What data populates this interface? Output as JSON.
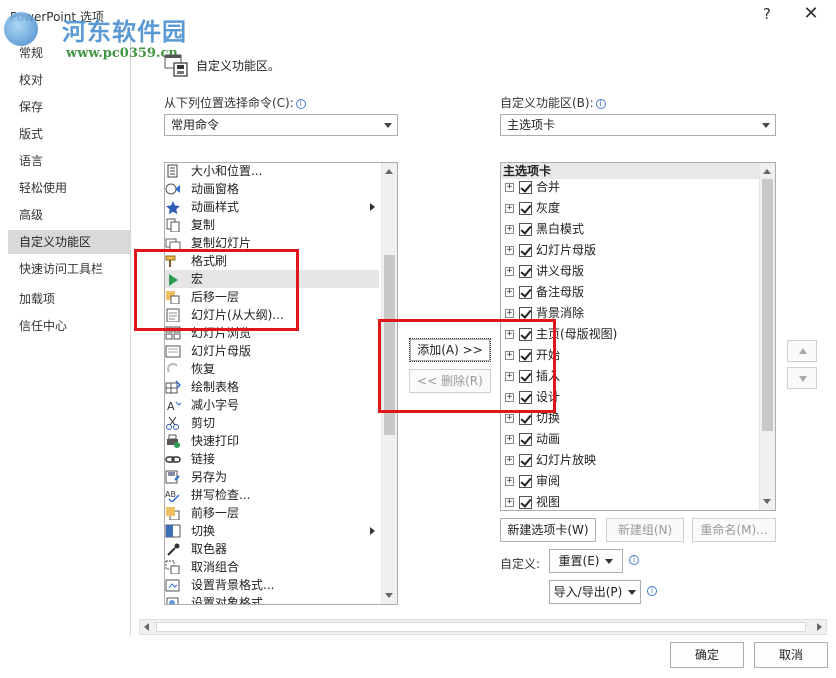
{
  "window": {
    "title": "PowerPoint 选项",
    "help": "?",
    "close": "✕"
  },
  "watermark": {
    "text": "河东软件园",
    "url": "www.pc0359.cn"
  },
  "sidebar": {
    "items": [
      {
        "label": "常规"
      },
      {
        "label": "校对"
      },
      {
        "label": "保存"
      },
      {
        "label": "版式"
      },
      {
        "label": "语言"
      },
      {
        "label": "轻松使用"
      },
      {
        "label": "高级"
      },
      {
        "label": "自定义功能区",
        "active": true
      },
      {
        "label": "快速访问工具栏"
      },
      {
        "label": "加载项"
      },
      {
        "label": "信任中心"
      }
    ]
  },
  "header": {
    "title": "自定义功能区。"
  },
  "left_panel": {
    "label": "从下列位置选择命令(C):",
    "combo_value": "常用命令",
    "commands": [
      {
        "label": "大小和位置...",
        "icon": "size-position-icon"
      },
      {
        "label": "动画窗格",
        "icon": "animation-pane-icon"
      },
      {
        "label": "动画样式",
        "icon": "star-icon",
        "submenu": true
      },
      {
        "label": "复制",
        "icon": "copy-icon"
      },
      {
        "label": "复制幻灯片",
        "icon": "duplicate-slide-icon"
      },
      {
        "label": "格式刷",
        "icon": "format-painter-icon"
      },
      {
        "label": "宏",
        "icon": "macro-icon",
        "selected": true
      },
      {
        "label": "后移一层",
        "icon": "send-backward-icon"
      },
      {
        "label": "幻灯片(从大纲)...",
        "icon": "slides-from-outline-icon"
      },
      {
        "label": "幻灯片浏览",
        "icon": "slide-sorter-icon"
      },
      {
        "label": "幻灯片母版",
        "icon": "slide-master-icon"
      },
      {
        "label": "恢复",
        "icon": "redo-icon"
      },
      {
        "label": "绘制表格",
        "icon": "draw-table-icon"
      },
      {
        "label": "减小字号",
        "icon": "decrease-font-icon"
      },
      {
        "label": "剪切",
        "icon": "scissors-icon"
      },
      {
        "label": "快速打印",
        "icon": "quick-print-icon"
      },
      {
        "label": "链接",
        "icon": "link-icon"
      },
      {
        "label": "另存为",
        "icon": "save-as-icon"
      },
      {
        "label": "拼写检查...",
        "icon": "spell-check-icon"
      },
      {
        "label": "前移一层",
        "icon": "bring-forward-icon"
      },
      {
        "label": "切换",
        "icon": "transition-icon",
        "submenu": true
      },
      {
        "label": "取色器",
        "icon": "eyedropper-icon"
      },
      {
        "label": "取消组合",
        "icon": "ungroup-icon"
      },
      {
        "label": "设置背景格式...",
        "icon": "format-background-icon"
      },
      {
        "label": "设置对象格式",
        "icon": "format-object-icon"
      }
    ]
  },
  "middle": {
    "add_label": "添加(A) >>",
    "remove_label": "<< 删除(R)"
  },
  "right_panel": {
    "label": "自定义功能区(B):",
    "combo_value": "主选项卡",
    "tree_header": "主选项卡",
    "tabs": [
      {
        "label": "合并"
      },
      {
        "label": "灰度"
      },
      {
        "label": "黑白模式"
      },
      {
        "label": "幻灯片母版"
      },
      {
        "label": "讲义母版"
      },
      {
        "label": "备注母版"
      },
      {
        "label": "背景消除"
      },
      {
        "label": "主页(母版视图)"
      },
      {
        "label": "开始"
      },
      {
        "label": "插入"
      },
      {
        "label": "设计"
      },
      {
        "label": "切换"
      },
      {
        "label": "动画"
      },
      {
        "label": "幻灯片放映"
      },
      {
        "label": "审阅"
      },
      {
        "label": "视图"
      }
    ],
    "expand_glyph": "+",
    "new_tab_label": "新建选项卡(W)",
    "new_group_label": "新建组(N)",
    "rename_label": "重命名(M)...",
    "customize_label": "自定义:",
    "reset_label": "重置(E)",
    "import_export_label": "导入/导出(P)"
  },
  "footer": {
    "ok_label": "确定",
    "cancel_label": "取消"
  },
  "colors": {
    "highlight_box": "#e0161b",
    "active_nav": "#d9d9d9"
  }
}
